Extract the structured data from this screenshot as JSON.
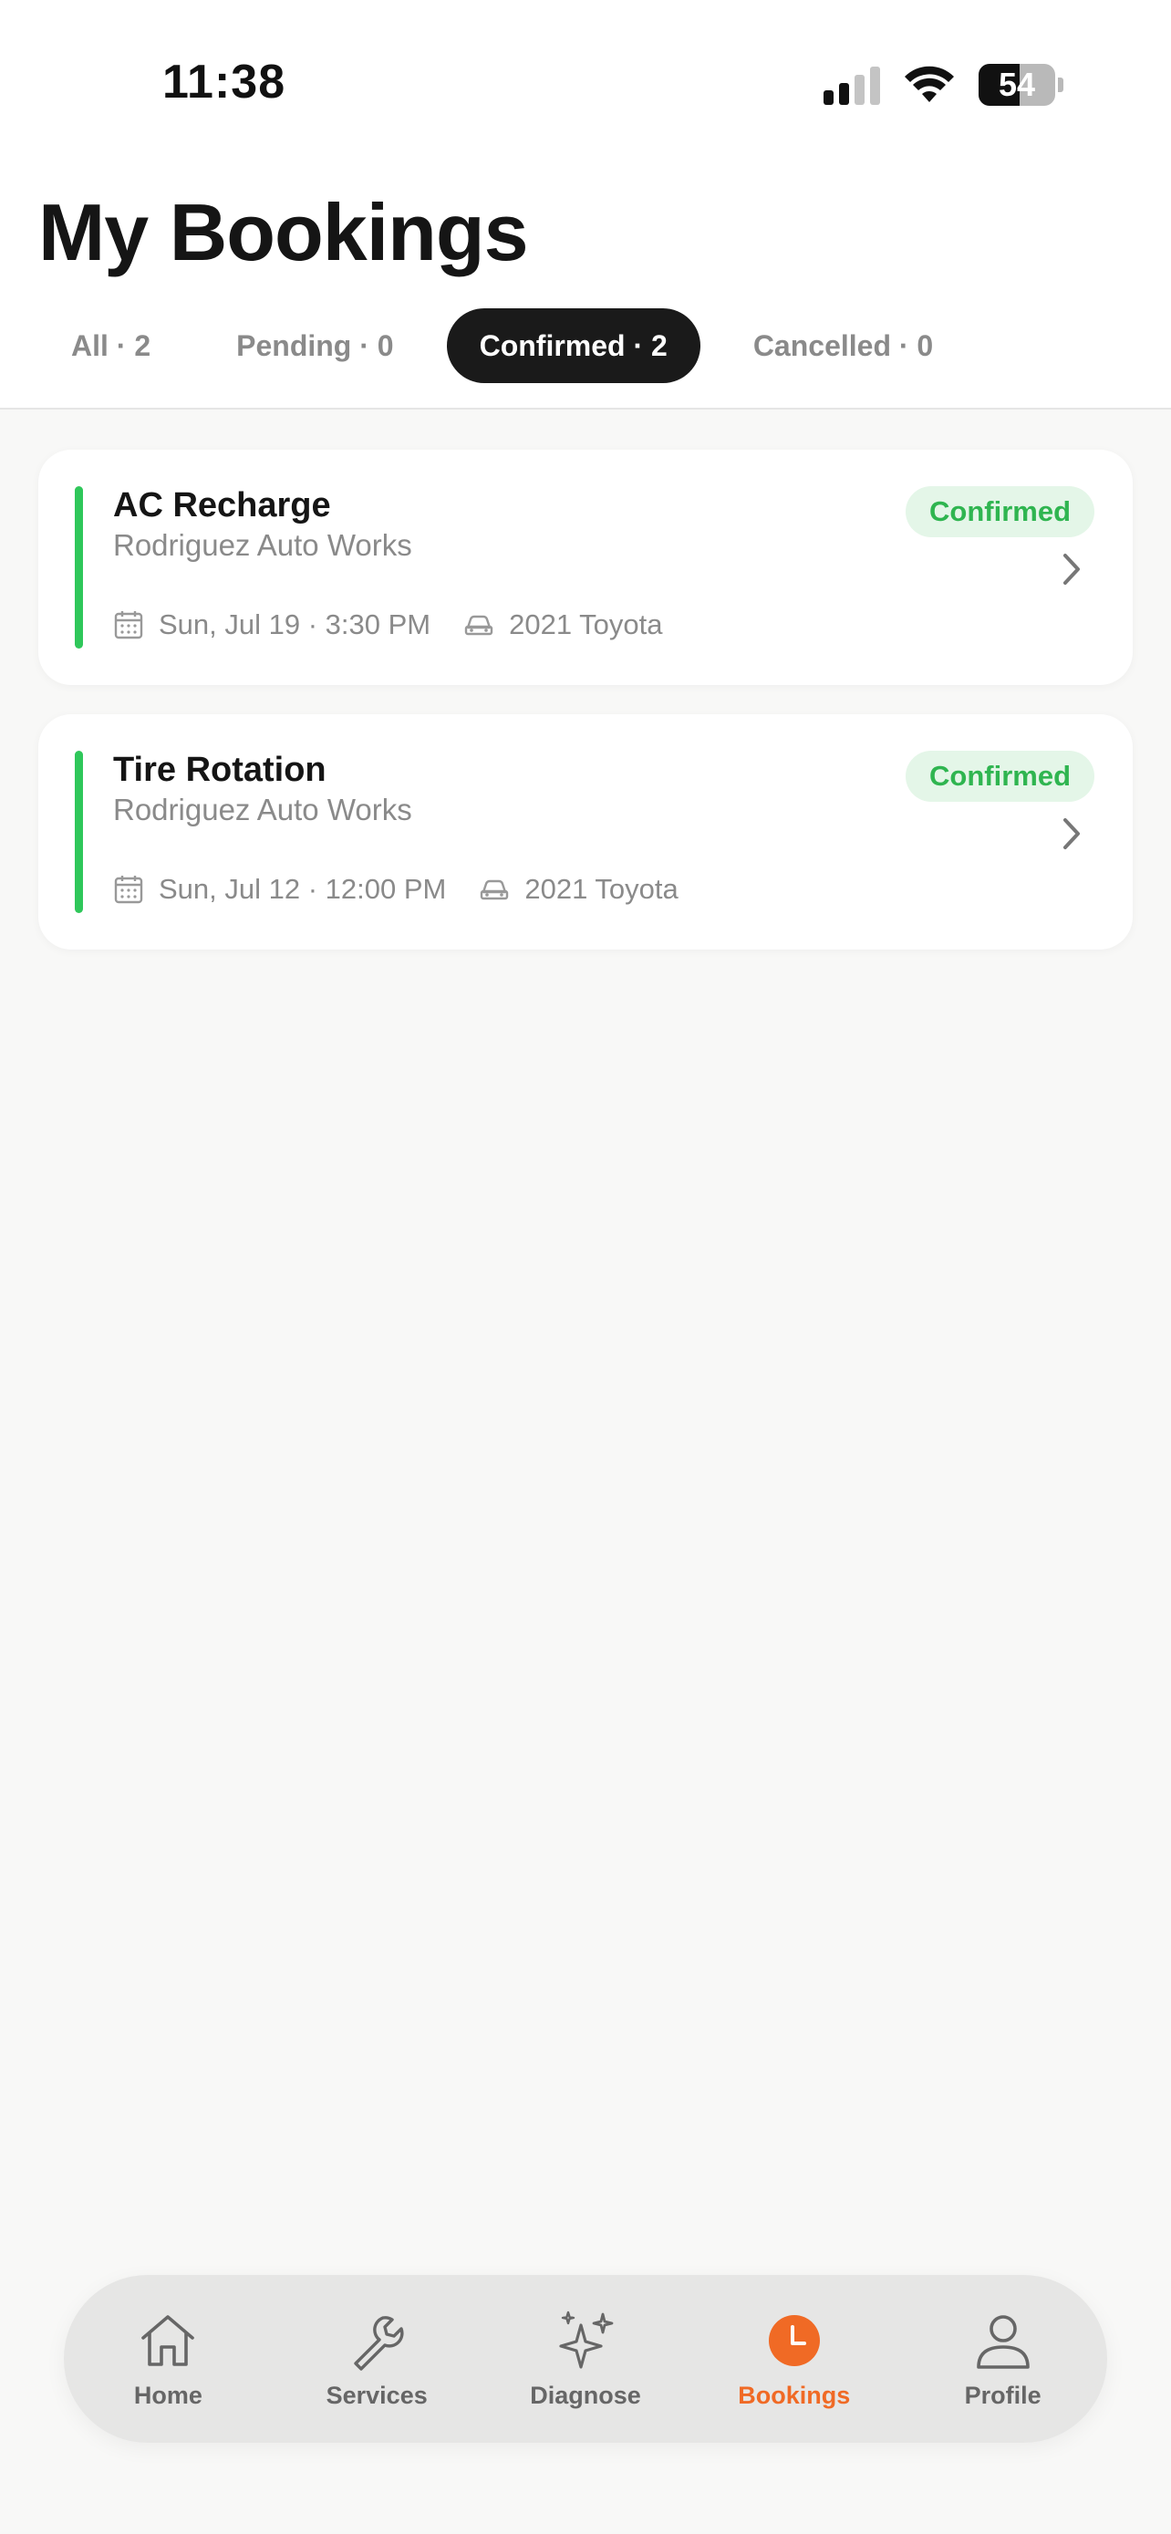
{
  "status_bar": {
    "time": "11:38",
    "battery_level": "54",
    "battery_fraction": 0.54,
    "signal_bars_active": 2,
    "signal_bars_total": 4
  },
  "page": {
    "title": "My Bookings"
  },
  "filters": [
    {
      "label": "All · 2",
      "active": false
    },
    {
      "label": "Pending · 0",
      "active": false
    },
    {
      "label": "Confirmed · 2",
      "active": true
    },
    {
      "label": "Cancelled · 0",
      "active": false
    }
  ],
  "bookings": [
    {
      "service": "AC Recharge",
      "shop": "Rodriguez Auto Works",
      "status": "Confirmed",
      "datetime": "Sun, Jul 19 · 3:30 PM",
      "vehicle": "2021 Toyota"
    },
    {
      "service": "Tire Rotation",
      "shop": "Rodriguez Auto Works",
      "status": "Confirmed",
      "datetime": "Sun, Jul 12 · 12:00 PM",
      "vehicle": "2021 Toyota"
    }
  ],
  "nav": {
    "items": [
      {
        "label": "Home",
        "icon": "home-icon",
        "active": false
      },
      {
        "label": "Services",
        "icon": "wrench-icon",
        "active": false
      },
      {
        "label": "Diagnose",
        "icon": "sparkles-icon",
        "active": false
      },
      {
        "label": "Bookings",
        "icon": "clock-icon",
        "active": true
      },
      {
        "label": "Profile",
        "icon": "user-icon",
        "active": false
      }
    ]
  },
  "colors": {
    "accent": "#f06a25",
    "confirmed": "#2fc75a",
    "confirmed_badge_bg": "#e4f6e8",
    "active_tab_bg": "#1a1a1a"
  }
}
